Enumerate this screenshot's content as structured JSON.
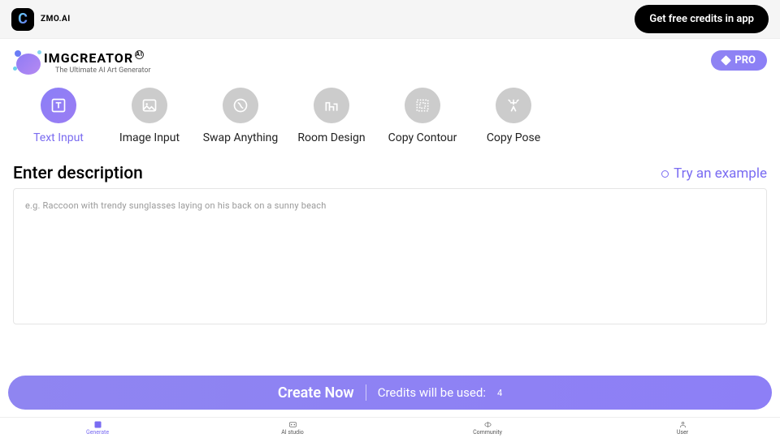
{
  "topbar": {
    "brand": "ZMO.AI",
    "credits_btn": "Get free credits in app"
  },
  "header": {
    "brand_name": "IMGCREATOR",
    "brand_ai": "AI",
    "brand_sub": "The Ultimate AI Art Generator",
    "pro_btn": "PRO"
  },
  "modes": [
    {
      "label": "Text Input",
      "icon": "text-icon"
    },
    {
      "label": "Image Input",
      "icon": "image-icon"
    },
    {
      "label": "Swap Anything",
      "icon": "swap-icon"
    },
    {
      "label": "Room Design",
      "icon": "room-icon"
    },
    {
      "label": "Copy Contour",
      "icon": "contour-icon"
    },
    {
      "label": "Copy Pose",
      "icon": "pose-icon"
    }
  ],
  "section": {
    "title": "Enter description",
    "try_example": "Try an example"
  },
  "textarea": {
    "placeholder": "e.g. Raccoon with trendy sunglasses laying on his back on a sunny beach",
    "value": ""
  },
  "cta": {
    "main": "Create Now",
    "sub": "Credits will be used:",
    "count": "4"
  },
  "bottomnav": [
    {
      "label": "Generate"
    },
    {
      "label": "AI studio"
    },
    {
      "label": "Community"
    },
    {
      "label": "User"
    }
  ]
}
